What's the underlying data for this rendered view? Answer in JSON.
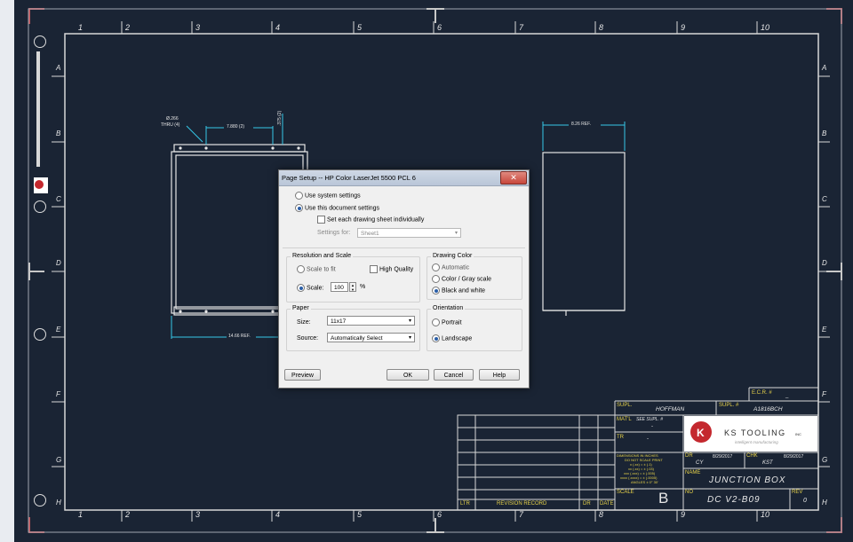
{
  "drawing": {
    "zone_numbers_top": [
      "1",
      "2",
      "3",
      "4",
      "5",
      "6",
      "7",
      "8",
      "9",
      "10"
    ],
    "zone_numbers_bottom": [
      "1",
      "2",
      "3",
      "4",
      "5",
      "6",
      "7",
      "8",
      "9",
      "10"
    ],
    "zone_letters_left": [
      "A",
      "B",
      "C",
      "D",
      "E",
      "F",
      "G",
      "H"
    ],
    "zone_letters_right": [
      "A",
      "B",
      "C",
      "D",
      "E",
      "F",
      "G",
      "H"
    ],
    "dims": {
      "hole_callout_1": "Ø.266",
      "hole_callout_2": "THRU (4)",
      "top_dim": "7.880 (2)",
      "vert_dim": ".375 (2)",
      "bottom_dim": "14.66 REF.",
      "side_dim": "8.26 REF."
    },
    "colors": {
      "background": "#1a2434",
      "lines": "#e6e6e6",
      "cyan": "#35c8e8",
      "border_red": "#c4575d",
      "title_yellow": "#e8d34a"
    }
  },
  "dialog": {
    "title": "Page Setup -- HP Color LaserJet 5500 PCL 6",
    "close_label": "✕",
    "use_system": "Use system settings",
    "use_document": "Use this document settings",
    "set_each": "Set each drawing sheet individually",
    "settings_for_label": "Settings for:",
    "settings_for_value": "Sheet1",
    "resolution_group": "Resolution and Scale",
    "scale_to_fit": "Scale to fit",
    "high_quality": "High Quality",
    "scale_label": "Scale:",
    "scale_value": "100",
    "scale_unit": "%",
    "color_group": "Drawing Color",
    "automatic": "Automatic",
    "color_gray": "Color / Gray scale",
    "black_white": "Black and white",
    "paper_group": "Paper",
    "size_label": "Size:",
    "size_value": "11x17",
    "source_label": "Source:",
    "source_value": "Automatically Select",
    "orientation_group": "Orientation",
    "portrait": "Portrait",
    "landscape": "Landscape",
    "preview_button": "Preview",
    "ok_button": "OK",
    "cancel_button": "Cancel",
    "help_button": "Help"
  },
  "title_block": {
    "ecr_label": "E.C.R. #",
    "ecr_value": "_",
    "supl_label": "SUPL.",
    "supl_value": "HOFFMAN",
    "supl_num_label": "SUPL. #",
    "supl_num_value": "A1816BCH",
    "matl_label": "MAT'L",
    "matl_value": "SEE SUPL. #",
    "matl_dash": "-",
    "tr_label": "TR",
    "tr_value": "-",
    "company": "KS TOOLING",
    "company_suffix": "INC",
    "company_tagline": "intelligent manufacturing",
    "dims_note_1": "DIMENSIONS IN INCHES",
    "dims_note_2": "DO NOT SCALE PRINT",
    "dims_note_3": "x (.xx) = ± (.1)",
    "dims_note_4": "xx (.xx) = ± (.03)",
    "dims_note_5": "xxx (.xxx) = ± (.005)",
    "dims_note_6": "xxxx (.xxxx) = ± (.0005)",
    "dims_note_7": "ANGLES ± 0° 30'",
    "dr_label": "DR",
    "dr_value": "CY",
    "dr_date": "8/29/2017",
    "chk_label": "CHK",
    "chk_value": "KST",
    "chk_date": "8/29/2017",
    "name_label": "NAME",
    "name_value": "JUNCTION BOX",
    "scale_label": "SCALE",
    "size_value": "B",
    "no_label": "NO",
    "no_value": "DC V2-B09",
    "rev_label": "REV",
    "rev_value": "0",
    "ltr_label": "LTR",
    "revision_record": "REVISION RECORD",
    "dr_col": "DR",
    "date_col": "DATE"
  }
}
